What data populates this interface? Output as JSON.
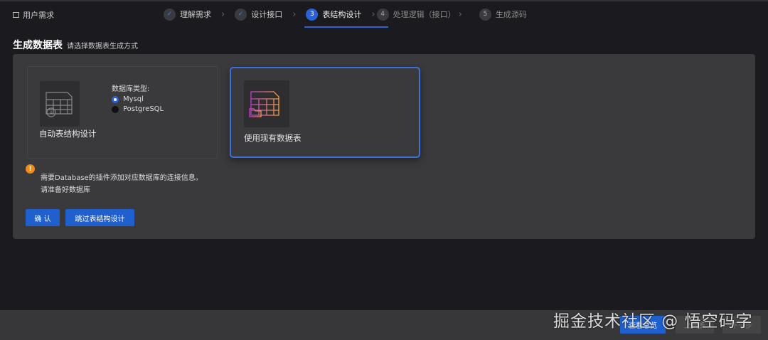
{
  "header": {
    "requirement": "用户需求",
    "steps": [
      {
        "num": "1",
        "label": "理解需求",
        "state": "done"
      },
      {
        "num": "2",
        "label": "设计接口",
        "state": "done"
      },
      {
        "num": "3",
        "label": "表结构设计",
        "state": "active"
      },
      {
        "num": "4",
        "label": "处理逻辑（接口）",
        "state": "todo"
      },
      {
        "num": "5",
        "label": "生成源码",
        "state": "todo"
      }
    ]
  },
  "section": {
    "title": "生成数据表",
    "subtitle": "请选择数据表生成方式"
  },
  "auto_card": {
    "label": "自动表结构设计",
    "db_type_label": "数据库类型:",
    "options": [
      {
        "label": "Mysql",
        "selected": true
      },
      {
        "label": "PostgreSQL",
        "selected": false
      }
    ]
  },
  "existing_card": {
    "label": "使用现有数据表"
  },
  "warning": {
    "line1": "需要Database的插件添加对应数据库的连接信息。",
    "line2": "请准备好数据库"
  },
  "buttons": {
    "confirm": "确 认",
    "skip": "跳过表结构设计"
  },
  "footer": {
    "overview": "查看总览",
    "prev": "上一步",
    "next": "下一步"
  },
  "watermark": "掘金技术社区 @ 悟空码字"
}
